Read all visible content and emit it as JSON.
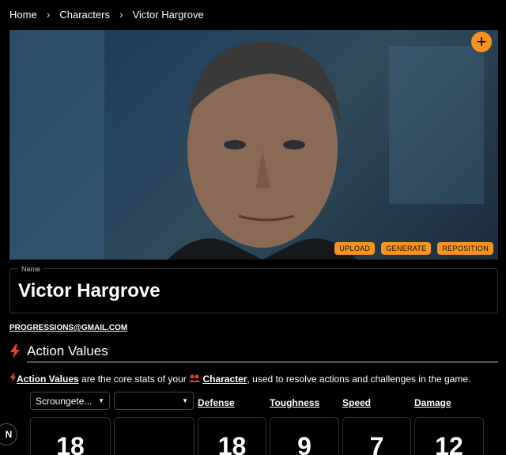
{
  "breadcrumb": {
    "home": "Home",
    "section": "Characters",
    "current": "Victor Hargrove"
  },
  "hero": {
    "add_label": "+",
    "actions": {
      "upload": "UPLOAD",
      "generate": "GENERATE",
      "reposition": "REPOSITION"
    }
  },
  "name_field": {
    "label": "Name",
    "value": "Victor Hargrove"
  },
  "email": "PROGRESSIONS@GMAIL.COM",
  "section": {
    "title": "Action Values"
  },
  "description": {
    "link1": "Action Values",
    "text1": " are the core stats of your ",
    "link2": "Character",
    "text2": ", used to resolve actions and challenges in the game."
  },
  "selects": {
    "primary": "Scroungete...",
    "secondary": ""
  },
  "stats": {
    "defense": "Defense",
    "toughness": "Toughness",
    "speed": "Speed",
    "damage": "Damage"
  },
  "values": {
    "primary": "18",
    "secondary": "",
    "defense": "18",
    "toughness": "9",
    "speed": "7",
    "damage": "12"
  },
  "corner_button": "N",
  "colors": {
    "accent": "#f7941d",
    "icon_red": "#e8412f",
    "background": "#000000"
  }
}
